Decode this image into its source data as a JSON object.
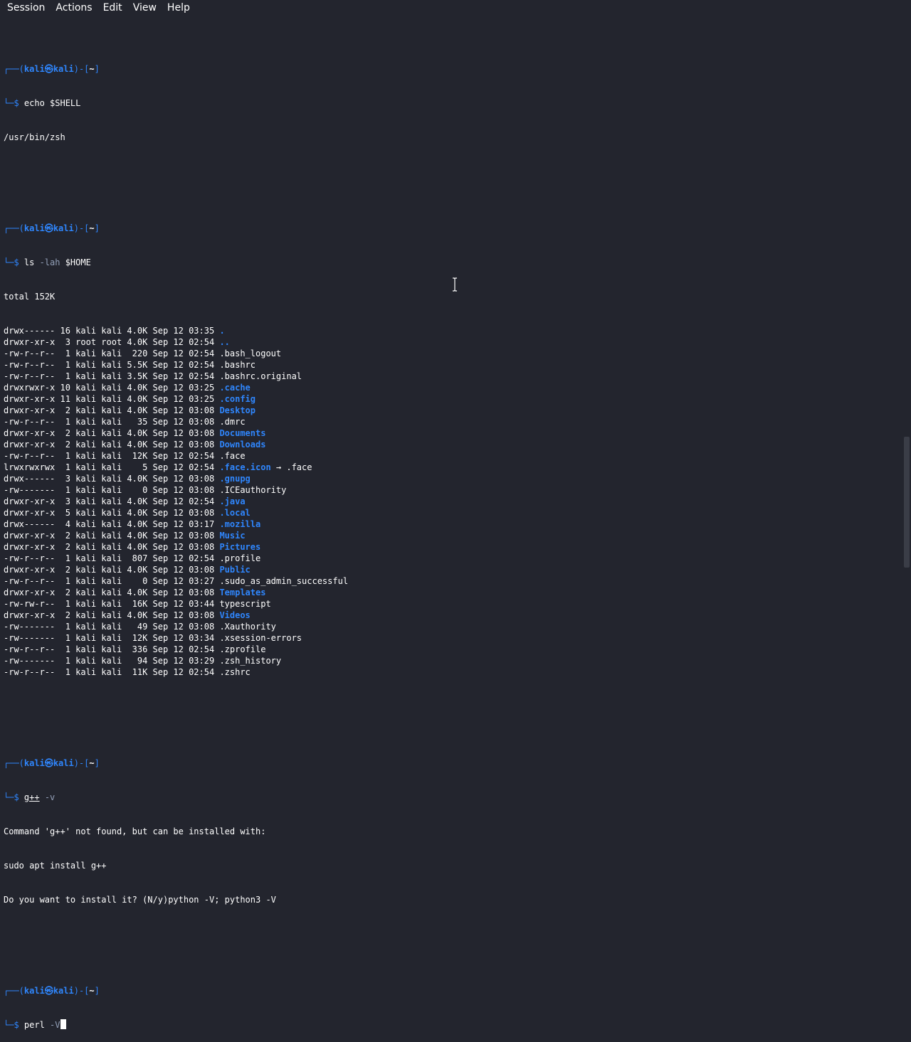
{
  "menu": [
    "Session",
    "Actions",
    "Edit",
    "View",
    "Help"
  ],
  "prompt": {
    "frame_open": "┌──(",
    "user": "kali",
    "at": "㉿",
    "host": "kali",
    "frame_mid": ")-[",
    "path": "~",
    "frame_close": "]",
    "dollar_line": "└─$ "
  },
  "block1": {
    "cmd": "echo",
    "arg": " $SHELL",
    "output": "/usr/bin/zsh"
  },
  "block2": {
    "cmd": "ls",
    "arg": " -lah",
    "arg2": " $HOME",
    "total": "total 152K",
    "rows": [
      {
        "meta": "drwx------ 16 kali kali 4.0K Sep 12 03:35 ",
        "name": ".",
        "type": "dir"
      },
      {
        "meta": "drwxr-xr-x  3 root root 4.0K Sep 12 02:54 ",
        "name": "..",
        "type": "dir"
      },
      {
        "meta": "-rw-r--r--  1 kali kali  220 Sep 12 02:54 ",
        "name": ".bash_logout",
        "type": "file"
      },
      {
        "meta": "-rw-r--r--  1 kali kali 5.5K Sep 12 02:54 ",
        "name": ".bashrc",
        "type": "file"
      },
      {
        "meta": "-rw-r--r--  1 kali kali 3.5K Sep 12 02:54 ",
        "name": ".bashrc.original",
        "type": "file"
      },
      {
        "meta": "drwxrwxr-x 10 kali kali 4.0K Sep 12 03:25 ",
        "name": ".cache",
        "type": "dir"
      },
      {
        "meta": "drwxr-xr-x 11 kali kali 4.0K Sep 12 03:25 ",
        "name": ".config",
        "type": "dir"
      },
      {
        "meta": "drwxr-xr-x  2 kali kali 4.0K Sep 12 03:08 ",
        "name": "Desktop",
        "type": "dir"
      },
      {
        "meta": "-rw-r--r--  1 kali kali   35 Sep 12 03:08 ",
        "name": ".dmrc",
        "type": "file"
      },
      {
        "meta": "drwxr-xr-x  2 kali kali 4.0K Sep 12 03:08 ",
        "name": "Documents",
        "type": "dir"
      },
      {
        "meta": "drwxr-xr-x  2 kali kali 4.0K Sep 12 03:08 ",
        "name": "Downloads",
        "type": "dir"
      },
      {
        "meta": "-rw-r--r--  1 kali kali  12K Sep 12 02:54 ",
        "name": ".face",
        "type": "file"
      },
      {
        "meta": "lrwxrwxrwx  1 kali kali    5 Sep 12 02:54 ",
        "name": ".face.icon",
        "type": "link",
        "target": " → .face"
      },
      {
        "meta": "drwx------  3 kali kali 4.0K Sep 12 03:08 ",
        "name": ".gnupg",
        "type": "dir"
      },
      {
        "meta": "-rw-------  1 kali kali    0 Sep 12 03:08 ",
        "name": ".ICEauthority",
        "type": "file"
      },
      {
        "meta": "drwxr-xr-x  3 kali kali 4.0K Sep 12 02:54 ",
        "name": ".java",
        "type": "dir"
      },
      {
        "meta": "drwxr-xr-x  5 kali kali 4.0K Sep 12 03:08 ",
        "name": ".local",
        "type": "dir"
      },
      {
        "meta": "drwx------  4 kali kali 4.0K Sep 12 03:17 ",
        "name": ".mozilla",
        "type": "dir"
      },
      {
        "meta": "drwxr-xr-x  2 kali kali 4.0K Sep 12 03:08 ",
        "name": "Music",
        "type": "dir"
      },
      {
        "meta": "drwxr-xr-x  2 kali kali 4.0K Sep 12 03:08 ",
        "name": "Pictures",
        "type": "dir"
      },
      {
        "meta": "-rw-r--r--  1 kali kali  807 Sep 12 02:54 ",
        "name": ".profile",
        "type": "file"
      },
      {
        "meta": "drwxr-xr-x  2 kali kali 4.0K Sep 12 03:08 ",
        "name": "Public",
        "type": "dir"
      },
      {
        "meta": "-rw-r--r--  1 kali kali    0 Sep 12 03:27 ",
        "name": ".sudo_as_admin_successful",
        "type": "file"
      },
      {
        "meta": "drwxr-xr-x  2 kali kali 4.0K Sep 12 03:08 ",
        "name": "Templates",
        "type": "dir"
      },
      {
        "meta": "-rw-rw-r--  1 kali kali  16K Sep 12 03:44 ",
        "name": "typescript",
        "type": "file"
      },
      {
        "meta": "drwxr-xr-x  2 kali kali 4.0K Sep 12 03:08 ",
        "name": "Videos",
        "type": "dir"
      },
      {
        "meta": "-rw-------  1 kali kali   49 Sep 12 03:08 ",
        "name": ".Xauthority",
        "type": "file"
      },
      {
        "meta": "-rw-------  1 kali kali  12K Sep 12 03:34 ",
        "name": ".xsession-errors",
        "type": "file"
      },
      {
        "meta": "-rw-r--r--  1 kali kali  336 Sep 12 02:54 ",
        "name": ".zprofile",
        "type": "file"
      },
      {
        "meta": "-rw-------  1 kali kali   94 Sep 12 03:29 ",
        "name": ".zsh_history",
        "type": "file"
      },
      {
        "meta": "-rw-r--r--  1 kali kali  11K Sep 12 02:54 ",
        "name": ".zshrc",
        "type": "file"
      }
    ]
  },
  "block3": {
    "cmd": "g++",
    "arg": " -v",
    "out1": "Command 'g++' not found, but can be installed with:",
    "out2": "sudo apt install g++",
    "out3": "Do you want to install it? (N/y)python -V; python3 -V"
  },
  "block4": {
    "cmd": "perl",
    "arg": " -V"
  },
  "colors": {
    "background": "#23252e",
    "accent_blue": "#2f86fd",
    "arg_grey": "#93a0b8"
  },
  "icons": [
    "text-cursor-ibeam-icon"
  ]
}
